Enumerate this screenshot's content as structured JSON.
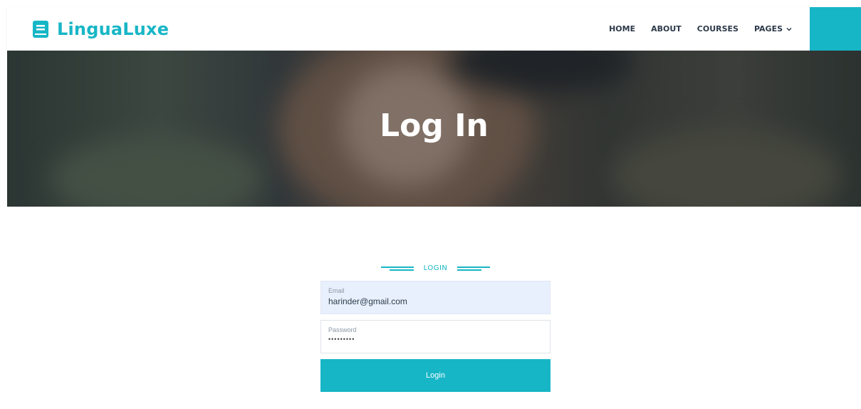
{
  "brand": {
    "name": "LinguaLuxe",
    "icon": "book-icon",
    "color": "#17b6c6"
  },
  "nav": {
    "items": [
      {
        "label": "HOME"
      },
      {
        "label": "ABOUT"
      },
      {
        "label": "COURSES"
      },
      {
        "label": "PAGES"
      }
    ],
    "dropdown_icon": "chevron-down-icon"
  },
  "hero": {
    "title": "Log In"
  },
  "login": {
    "section_label": "LOGIN",
    "email_label": "Email",
    "email_value": "harinder@gmail.com",
    "password_label": "Password",
    "password_value": "•••••••••",
    "button_label": "Login"
  },
  "colors": {
    "accent": "#17b6c6",
    "email_bg": "#e8f0fe",
    "nav_text": "#2d3a4a"
  }
}
